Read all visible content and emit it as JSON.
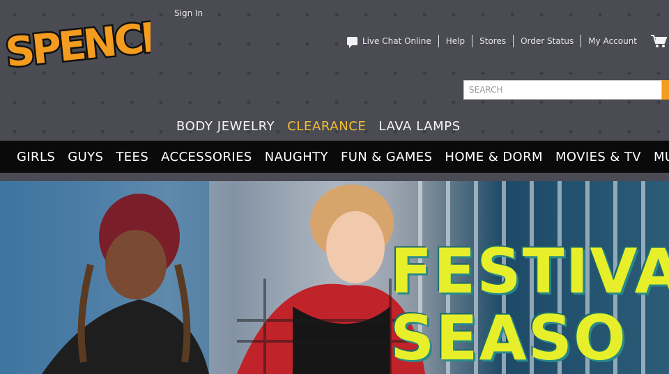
{
  "header": {
    "logo_text": "SPENCER'S",
    "sign_in": "Sign In",
    "utility_links": [
      {
        "label": "Live Chat Online",
        "icon": "chat-icon"
      },
      {
        "label": "Help"
      },
      {
        "label": "Stores"
      },
      {
        "label": "Order Status"
      },
      {
        "label": "My Account"
      }
    ],
    "cart_icon": "cart-icon",
    "search": {
      "placeholder": "SEARCH"
    },
    "brand_color": "#f39c1f"
  },
  "promo_nav": [
    {
      "label": "BODY JEWELRY"
    },
    {
      "label": "CLEARANCE",
      "highlight": "#f3c030"
    },
    {
      "label": "LAVA LAMPS"
    }
  ],
  "main_nav": [
    {
      "label": "GIRLS"
    },
    {
      "label": "GUYS"
    },
    {
      "label": "TEES"
    },
    {
      "label": "ACCESSORIES"
    },
    {
      "label": "NAUGHTY"
    },
    {
      "label": "FUN & GAMES"
    },
    {
      "label": "HOME & DORM"
    },
    {
      "label": "MOVIES & TV"
    },
    {
      "label": "MU"
    }
  ],
  "hero": {
    "headline_line1": "FESTIVA",
    "headline_line2": "SEASO"
  }
}
